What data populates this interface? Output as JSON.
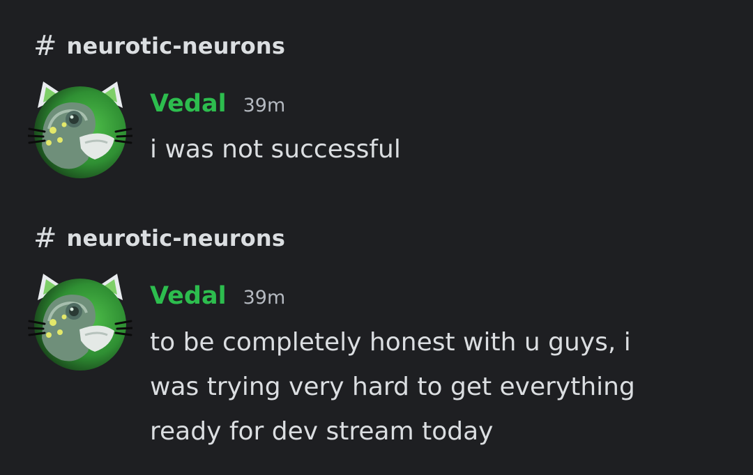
{
  "colors": {
    "background": "#1e1f22",
    "text": "#dbdee1",
    "muted": "#b5bac1",
    "author_green": "#2dbd4e"
  },
  "messages": [
    {
      "channel": "neurotic-neurons",
      "channel_icon": "hash-icon",
      "author": "Vedal",
      "timestamp": "39m",
      "avatar_icon": "turtle-cat-avatar",
      "text": "i was not successful"
    },
    {
      "channel": "neurotic-neurons",
      "channel_icon": "hash-icon",
      "author": "Vedal",
      "timestamp": "39m",
      "avatar_icon": "turtle-cat-avatar",
      "text": "to be completely honest with u guys, i was trying very hard to get everything ready for dev stream today"
    }
  ]
}
